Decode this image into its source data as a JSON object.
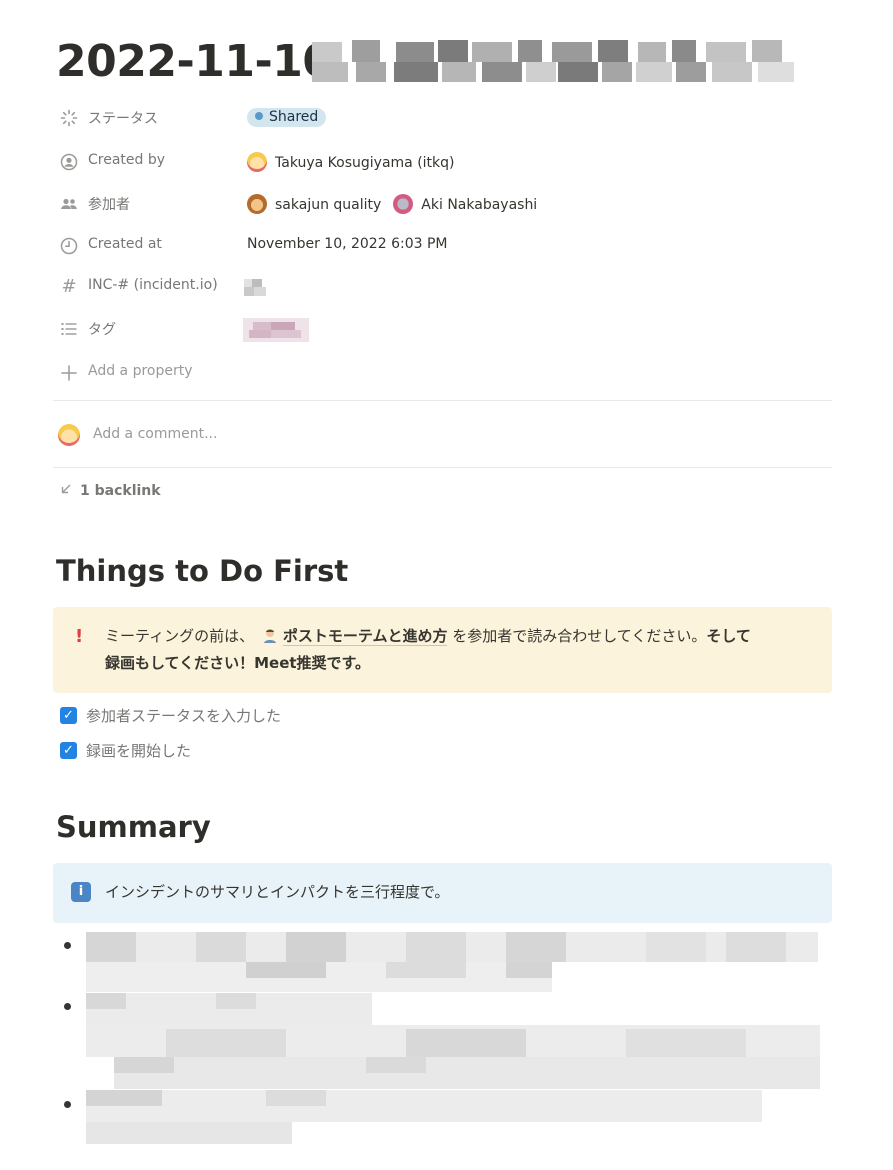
{
  "page": {
    "title_date": "2022-11-10",
    "properties": [
      {
        "icon": "status-icon",
        "name": "ステータス",
        "value": "Shared"
      },
      {
        "icon": "person-circle-icon",
        "name": "Created by",
        "value": "Takuya Kosugiyama (itkq)"
      },
      {
        "icon": "people-icon",
        "name": "参加者",
        "value_a": "sakajun quality",
        "value_b": "Aki Nakabayashi"
      },
      {
        "icon": "clock-icon",
        "name": "Created at",
        "value": "November 10, 2022 6:03 PM"
      },
      {
        "icon": "hash-icon",
        "name": "INC-# (incident.io)"
      },
      {
        "icon": "list-icon",
        "name": "タグ"
      }
    ],
    "add_property": "Add a property",
    "comment_placeholder": "Add a comment...",
    "backlinks": "1 backlink"
  },
  "sections": {
    "first_heading": "Things to Do First",
    "callout_warning": {
      "icon": "exclamation-icon",
      "text_before": "ミーティングの前は、",
      "link_text": "ポストモーテムと進め方",
      "text_middle": "を参加者で読み合わせしてください。",
      "text_bold_1": "そして",
      "text_bold_2": "録画もしてください！Meet推奨です。"
    },
    "checklist": [
      {
        "label": "参加者ステータスを入力した",
        "checked": true
      },
      {
        "label": "録画を開始した",
        "checked": true
      }
    ],
    "summary_heading": "Summary",
    "callout_info": {
      "icon": "info-icon",
      "text": "インシデントのサマリとインパクトを三行程度で。"
    }
  },
  "colors": {
    "badge_bg": "#d3e5ef",
    "warning_bg": "#fbf3db",
    "info_bg": "#e7f3f8",
    "checkbox": "#2383e2"
  }
}
